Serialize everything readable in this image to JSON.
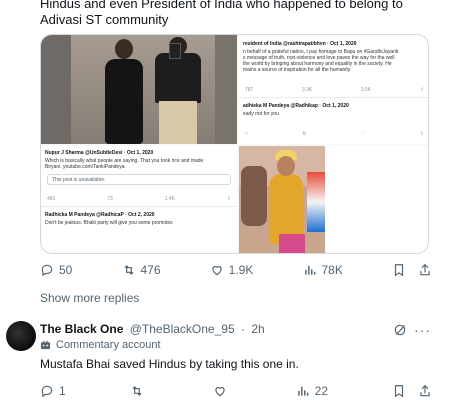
{
  "tweet": {
    "text": "Hindus and even President of India who happened to belong to Adivasi ST community"
  },
  "media": {
    "screenshot_b": {
      "line1": "resident of India @rashtrapatibhvn · Oct 1, 2020",
      "line2": "n behalf of a grateful nation, I pay homage to Bapu on #GandhiJayanti",
      "line3": "s message of truth, non-violence and love paves the way for the well",
      "line4": "the world by bringing about harmony and equality in the society. He",
      "line5": "mains a source of inspiration for all the humanity.",
      "stat1": "787",
      "stat2": "3.3K",
      "stat3": "3.5K",
      "reply_name": "adhieka M Pandeya @Radhikap · Oct 1, 2020",
      "reply_text": "eady not for you"
    },
    "screenshot_c": {
      "line1": "Nupur J Sharma @UnSubtleDesi · Oct 1, 2020",
      "line2": "Which is basically what people are saying. That you took rice and made",
      "line3": "Biryani. youtube.com/TankiPandeya",
      "quoted": "This post is unavailable.",
      "stat1": "481",
      "stat2": "73",
      "stat3": "1.4K",
      "reply_name": "Radhicka M Pandeya @RadhicaP · Oct 2, 2020",
      "reply_text": "Don't be jealous. Bhaki party will give you some promotes"
    }
  },
  "actions": {
    "replies": "50",
    "retweets": "476",
    "likes": "1.9K",
    "views": "78K"
  },
  "show_more": "Show more replies",
  "reply": {
    "name": "The Black One",
    "handle": "@TheBlackOne_95",
    "dot": "·",
    "time": "2h",
    "badge": "Commentary account",
    "text": "Mustafa Bhai saved Hindus by taking this one in.",
    "replies": "1",
    "retweets": "",
    "likes": "",
    "views": "22",
    "more": "···"
  },
  "icons": {
    "reply": "reply-icon",
    "retweet": "retweet-icon",
    "like": "heart-icon",
    "views": "views-icon",
    "bookmark": "bookmark-icon",
    "share": "share-icon",
    "grok": "grok-icon",
    "badge": "commentary-badge-icon"
  }
}
